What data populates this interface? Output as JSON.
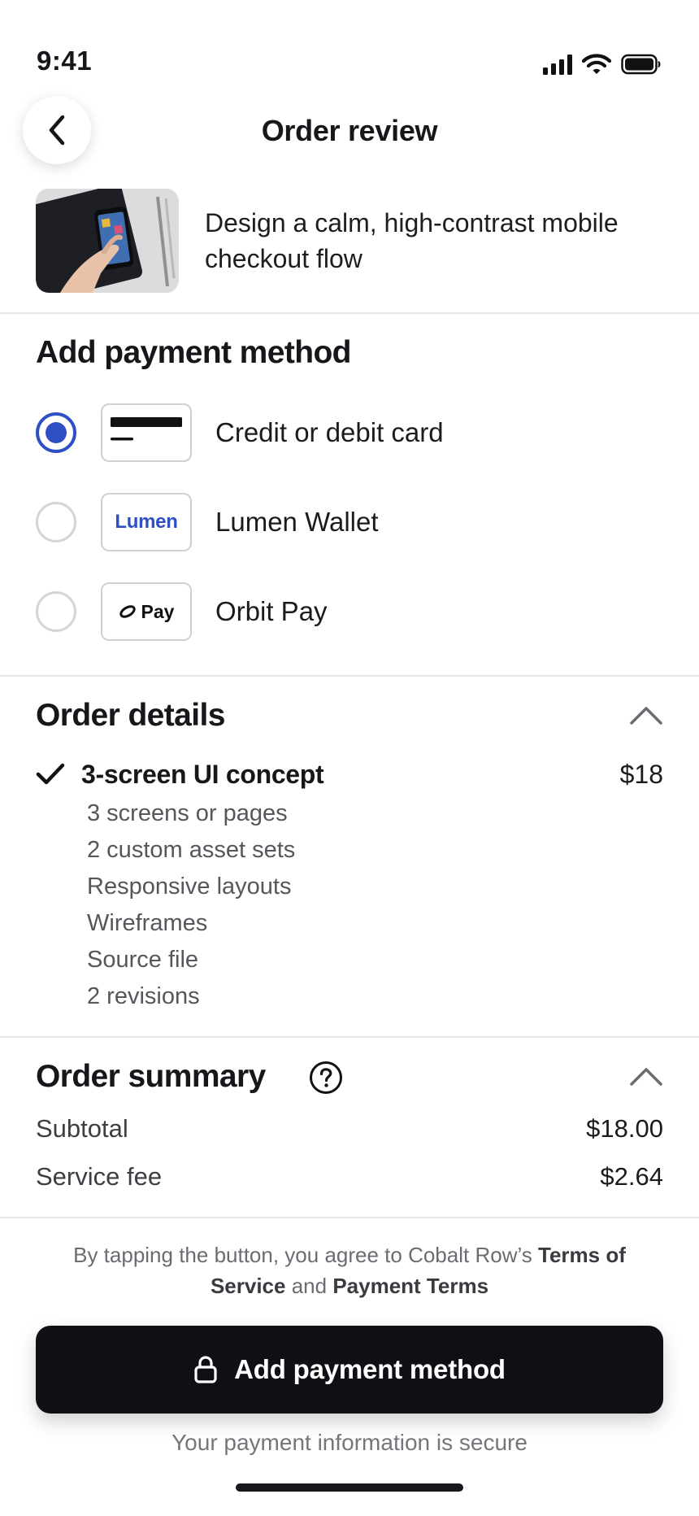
{
  "status_bar": {
    "time": "9:41"
  },
  "nav": {
    "title": "Order review"
  },
  "gig": {
    "title": "Design a calm, high-contrast mobile checkout flow"
  },
  "payment": {
    "heading": "Add payment method",
    "selected_index": 0,
    "options": [
      {
        "label": "Credit or debit card",
        "logo": "card-icon"
      },
      {
        "label": "Lumen Wallet",
        "logo_text": "Lumen"
      },
      {
        "label": "Orbit Pay",
        "logo_text": "Pay"
      }
    ]
  },
  "order_details": {
    "heading": "Order details",
    "package": "3-screen UI concept",
    "price": "$18",
    "features": [
      "3 screens or pages",
      "2 custom asset sets",
      "Responsive layouts",
      "Wireframes",
      "Source file",
      "2 revisions"
    ]
  },
  "order_summary": {
    "heading": "Order summary",
    "rows": [
      {
        "label": "Subtotal",
        "value": "$18.00"
      },
      {
        "label": "Service fee",
        "value": "$2.64"
      }
    ]
  },
  "footer": {
    "legal_prefix": "By tapping the button, you agree to Cobalt Row’s",
    "terms_of_service": "Terms of Service",
    "and": "and",
    "payment_terms": "Payment Terms",
    "cta_label": "Add payment method",
    "secure_note": "Your payment information is secure"
  },
  "colors": {
    "accent": "#2f4fc4",
    "cta_background": "#0f1016",
    "divider": "#e4e5e7"
  },
  "icons": [
    "signal-icon",
    "wifi-icon",
    "battery-icon",
    "back-arrow-icon",
    "chevron-up-icon",
    "checkmark-icon",
    "help-icon",
    "lock-icon"
  ]
}
